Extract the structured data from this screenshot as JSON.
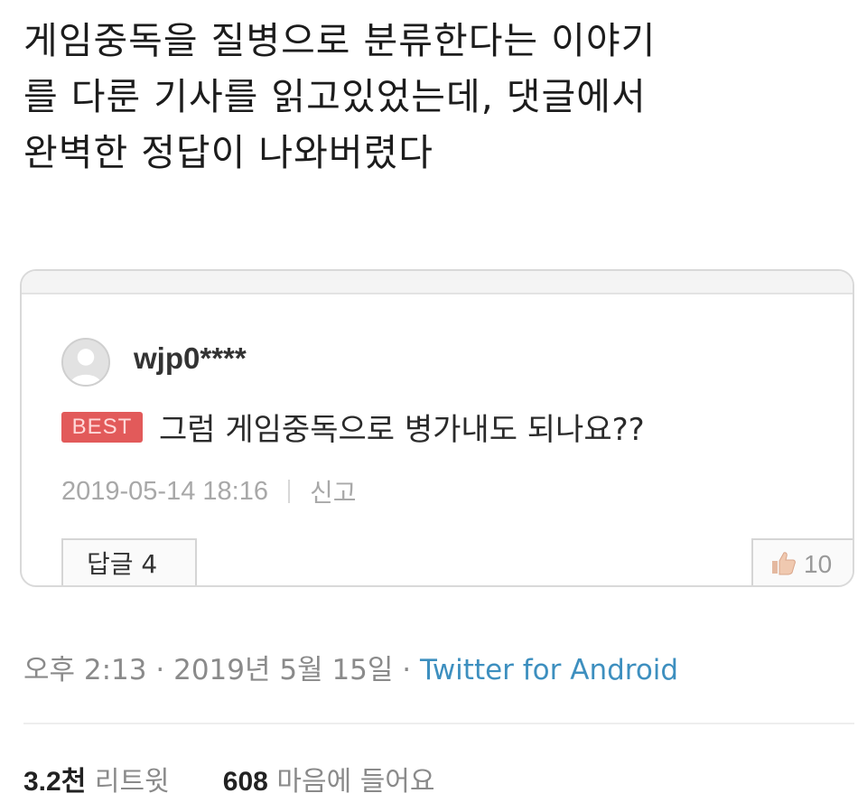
{
  "tweet": {
    "text": "게임중독을 질병으로 분류한다는 이야기\n를 다룬 기사를 읽고있었는데, 댓글에서\n완벽한 정답이 나와버렸다",
    "time": "오후 2:13",
    "separator": "·",
    "date": "2019년 5월 15일",
    "source": "Twitter for Android"
  },
  "embedded_comment": {
    "username": "wjp0****",
    "badge": "BEST",
    "text": "그럼 게임중독으로 병가내도 되나요??",
    "timestamp": "2019-05-14 18:16",
    "report_label": "신고",
    "reply_label": "답글 4",
    "like_count": "10",
    "colors": {
      "badge": "#e25a5a",
      "border": "#d9d9d9"
    },
    "icons": {
      "avatar": "default-user-avatar",
      "like": "thumbs-up-icon"
    }
  },
  "stats": {
    "retweets_count": "3.2천",
    "retweets_label": "리트윗",
    "likes_count": "608",
    "likes_label": "마음에 들어요"
  },
  "colors": {
    "link": "#3d8fbf",
    "muted": "#8a8a8a"
  }
}
